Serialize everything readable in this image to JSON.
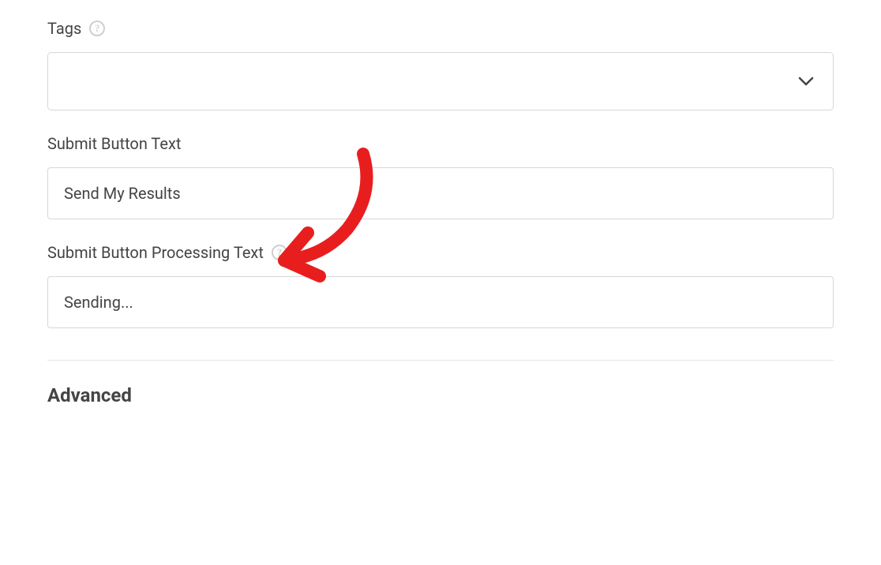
{
  "fields": {
    "tags": {
      "label": "Tags",
      "value": ""
    },
    "submitButtonText": {
      "label": "Submit Button Text",
      "value": "Send My Results"
    },
    "submitButtonProcessingText": {
      "label": "Submit Button Processing Text",
      "value": "Sending..."
    }
  },
  "sections": {
    "advanced": "Advanced"
  },
  "icons": {
    "helpGlyph": "?"
  },
  "annotation": {
    "arrowColor": "#e81e1e"
  }
}
